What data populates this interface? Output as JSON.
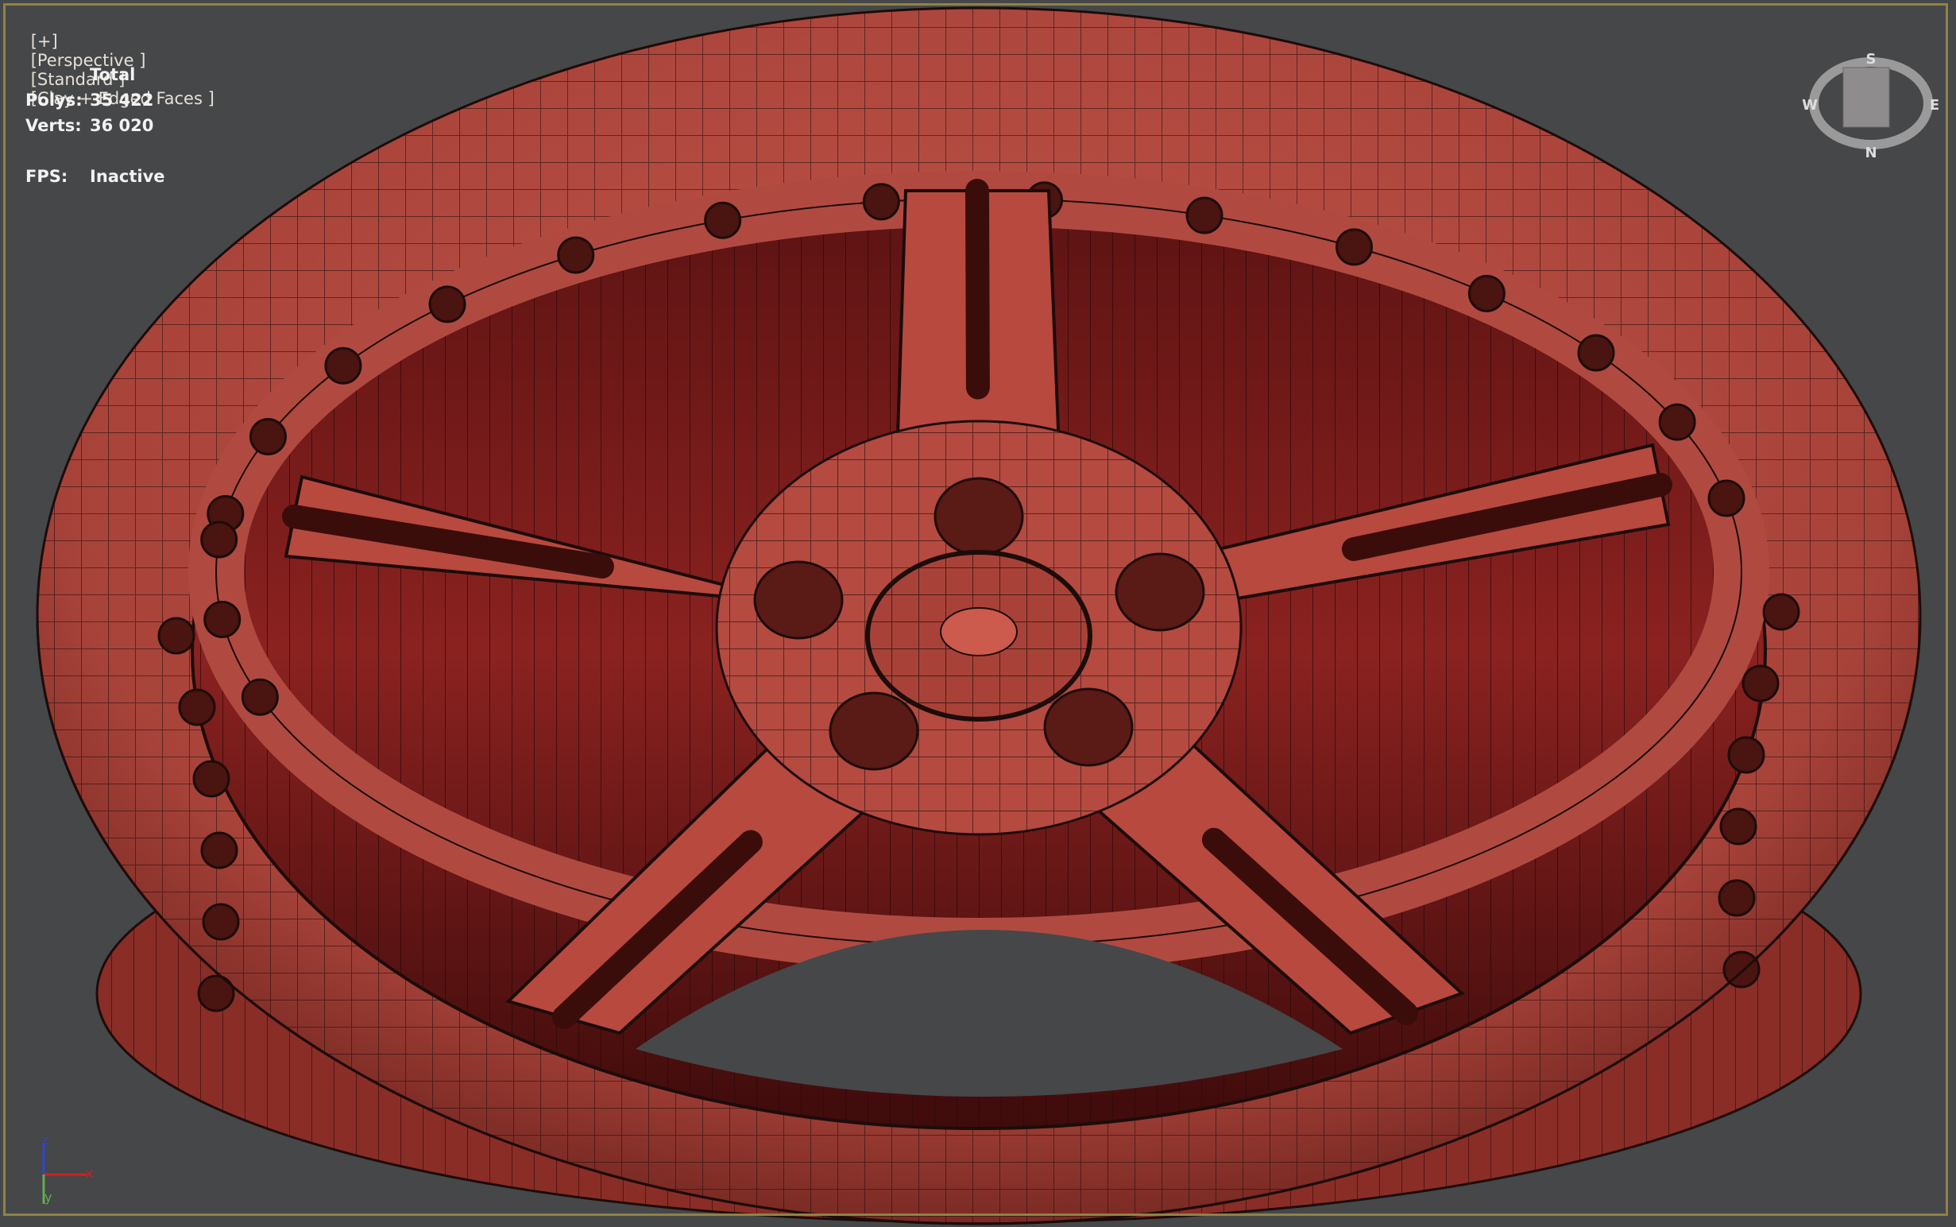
{
  "viewport": {
    "labels": [
      "[+]",
      "[Perspective ]",
      "[Standard ]",
      "[Clay + Edged Faces ]"
    ],
    "stats": {
      "header": "Total",
      "polys_label": "Polys:",
      "polys": "35 422",
      "verts_label": "Verts:",
      "verts": "36 020",
      "fps_label": "FPS:",
      "fps": "Inactive"
    },
    "viewcube": {
      "n": "N",
      "s": "S",
      "e": "E",
      "w": "W"
    },
    "axis": {
      "x": "x",
      "y": "y",
      "z": "z"
    }
  },
  "colors": {
    "background": "#454749",
    "frame": "#8f8246",
    "clay": "#b4483f",
    "edges": "#1c0c0a"
  }
}
